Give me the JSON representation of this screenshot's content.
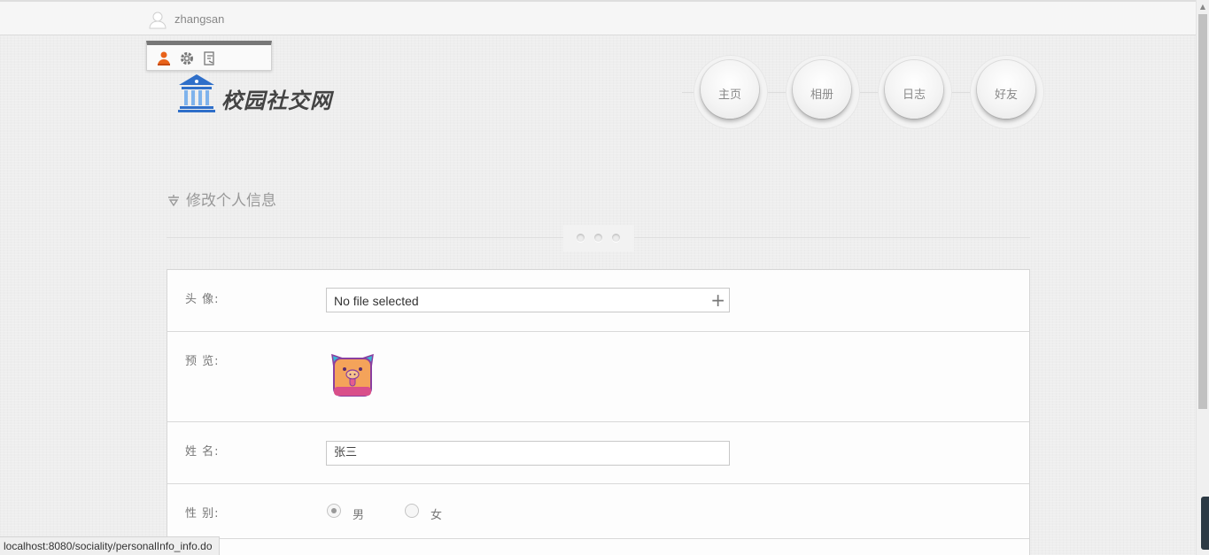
{
  "topbar": {
    "username": "zhangsan",
    "menu_icons": [
      "user-icon",
      "gear-icon",
      "logout-icon"
    ]
  },
  "logo": {
    "text": "校园社交网",
    "icon": "building-icon"
  },
  "nav": {
    "items": [
      {
        "label": "主页"
      },
      {
        "label": "相册"
      },
      {
        "label": "日志"
      },
      {
        "label": "好友"
      }
    ]
  },
  "section": {
    "title": "修改个人信息",
    "icon": "edit-icon"
  },
  "form": {
    "avatar_label": "头  像:",
    "avatar_file_text": "No file selected",
    "preview_label": "预  览:",
    "name_label": "姓  名:",
    "name_value": "张三",
    "gender_label": "性  别:",
    "gender_options": [
      "男",
      "女"
    ],
    "gender_selected": "男"
  },
  "status_bar": {
    "url": "localhost:8080/sociality/personalInfo_info.do"
  },
  "colors": {
    "accent_orange": "#e8621a",
    "logo_blue": "#2f6fc9",
    "avatar_orange": "#f4a35a",
    "avatar_purple": "#8a3fa0",
    "avatar_cyan": "#3ab7d6"
  }
}
